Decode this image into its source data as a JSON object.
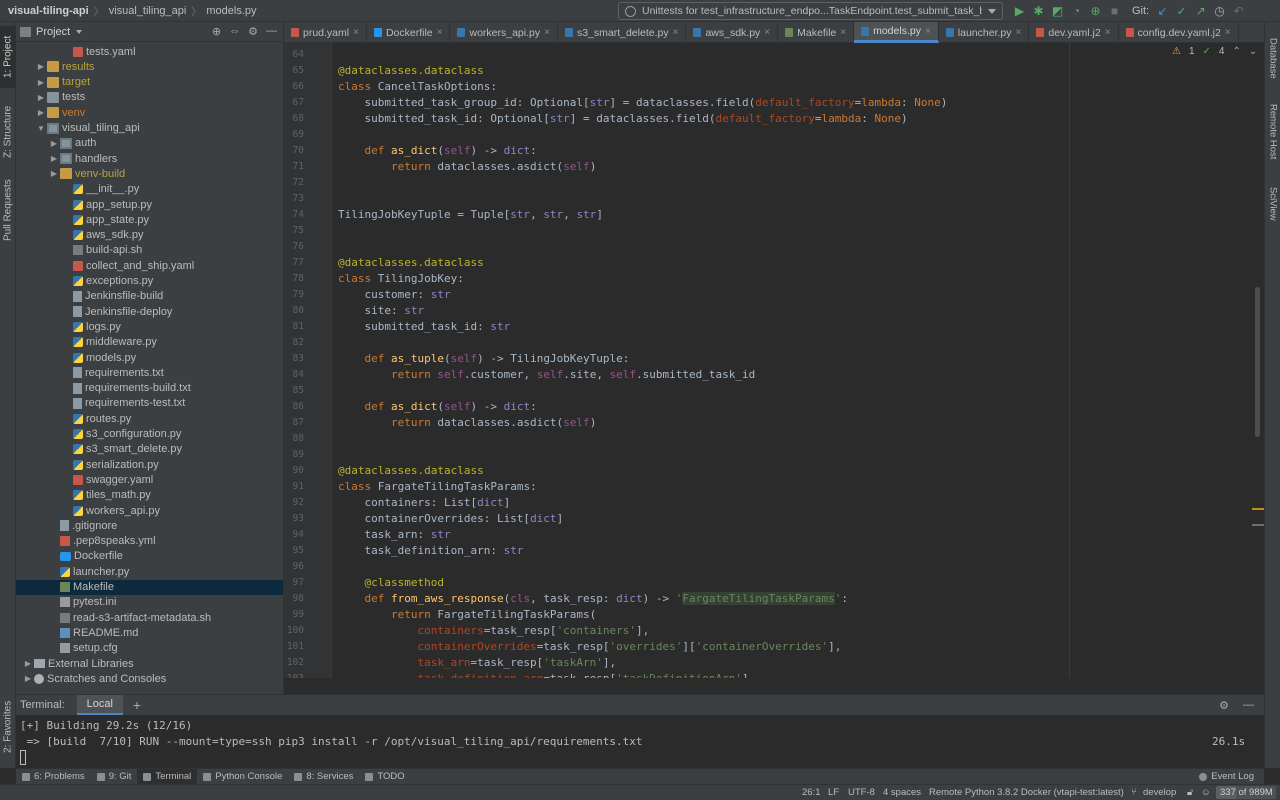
{
  "breadcrumb": {
    "project": "visual-tiling-api",
    "folder": "visual_tiling_api",
    "file": "models.py"
  },
  "run_config": {
    "label": "Unittests for test_infrastructure_endpo...TaskEndpoint.test_submit_task_bad_schema"
  },
  "toolbar": {
    "git_label": "Git:",
    "icons": [
      "run-icon",
      "debug-icon",
      "coverage-icon",
      "profile-icon",
      "concurrency-icon",
      "stop-icon",
      "git-update-icon",
      "git-commit-icon",
      "git-push-icon",
      "history-icon",
      "rollback-icon"
    ]
  },
  "left_strip": {
    "project_tab": "1: Project",
    "structure_tab": "Z: Structure",
    "pull_requests_tab": "Pull Requests",
    "favorites_tab": "2: Favorites"
  },
  "right_strip": {
    "database_tab": "Database",
    "remote_host_tab": "Remote Host",
    "sciview_tab": "SciView"
  },
  "project_panel": {
    "title": "Project",
    "rows": [
      {
        "label": "tests.yaml",
        "indent": 3,
        "icon": "yaml",
        "arrow": "",
        "style": ""
      },
      {
        "label": "results",
        "indent": 1,
        "icon": "folder-excl",
        "arrow": "▶",
        "style": "yellow"
      },
      {
        "label": "target",
        "indent": 1,
        "icon": "folder-excl",
        "arrow": "▶",
        "style": "yellow"
      },
      {
        "label": "tests",
        "indent": 1,
        "icon": "folder",
        "arrow": "▶",
        "style": ""
      },
      {
        "label": "venv",
        "indent": 1,
        "icon": "folder-excl",
        "arrow": "▶",
        "style": "orange"
      },
      {
        "label": "visual_tiling_api",
        "indent": 1,
        "icon": "folder-pkg",
        "arrow": "▼",
        "style": ""
      },
      {
        "label": "auth",
        "indent": 2,
        "icon": "folder-pkg",
        "arrow": "▶",
        "style": ""
      },
      {
        "label": "handlers",
        "indent": 2,
        "icon": "folder-pkg",
        "arrow": "▶",
        "style": ""
      },
      {
        "label": "venv-build",
        "indent": 2,
        "icon": "folder-excl",
        "arrow": "▶",
        "style": "yellow"
      },
      {
        "label": "__init__.py",
        "indent": 3,
        "icon": "py",
        "arrow": "",
        "style": ""
      },
      {
        "label": "app_setup.py",
        "indent": 3,
        "icon": "py",
        "arrow": "",
        "style": ""
      },
      {
        "label": "app_state.py",
        "indent": 3,
        "icon": "py",
        "arrow": "",
        "style": ""
      },
      {
        "label": "aws_sdk.py",
        "indent": 3,
        "icon": "py",
        "arrow": "",
        "style": ""
      },
      {
        "label": "build-api.sh",
        "indent": 3,
        "icon": "sh",
        "arrow": "",
        "style": ""
      },
      {
        "label": "collect_and_ship.yaml",
        "indent": 3,
        "icon": "yaml",
        "arrow": "",
        "style": ""
      },
      {
        "label": "exceptions.py",
        "indent": 3,
        "icon": "py",
        "arrow": "",
        "style": ""
      },
      {
        "label": "Jenkinsfile-build",
        "indent": 3,
        "icon": "txt",
        "arrow": "",
        "style": ""
      },
      {
        "label": "Jenkinsfile-deploy",
        "indent": 3,
        "icon": "txt",
        "arrow": "",
        "style": ""
      },
      {
        "label": "logs.py",
        "indent": 3,
        "icon": "py",
        "arrow": "",
        "style": ""
      },
      {
        "label": "middleware.py",
        "indent": 3,
        "icon": "py",
        "arrow": "",
        "style": ""
      },
      {
        "label": "models.py",
        "indent": 3,
        "icon": "py",
        "arrow": "",
        "style": ""
      },
      {
        "label": "requirements.txt",
        "indent": 3,
        "icon": "txt",
        "arrow": "",
        "style": ""
      },
      {
        "label": "requirements-build.txt",
        "indent": 3,
        "icon": "txt",
        "arrow": "",
        "style": ""
      },
      {
        "label": "requirements-test.txt",
        "indent": 3,
        "icon": "txt",
        "arrow": "",
        "style": ""
      },
      {
        "label": "routes.py",
        "indent": 3,
        "icon": "py",
        "arrow": "",
        "style": ""
      },
      {
        "label": "s3_configuration.py",
        "indent": 3,
        "icon": "py",
        "arrow": "",
        "style": ""
      },
      {
        "label": "s3_smart_delete.py",
        "indent": 3,
        "icon": "py",
        "arrow": "",
        "style": ""
      },
      {
        "label": "serialization.py",
        "indent": 3,
        "icon": "py",
        "arrow": "",
        "style": ""
      },
      {
        "label": "swagger.yaml",
        "indent": 3,
        "icon": "yaml",
        "arrow": "",
        "style": ""
      },
      {
        "label": "tiles_math.py",
        "indent": 3,
        "icon": "py",
        "arrow": "",
        "style": ""
      },
      {
        "label": "workers_api.py",
        "indent": 3,
        "icon": "py",
        "arrow": "",
        "style": ""
      },
      {
        "label": ".gitignore",
        "indent": 2,
        "icon": "txt",
        "arrow": "",
        "style": ""
      },
      {
        "label": ".pep8speaks.yml",
        "indent": 2,
        "icon": "yaml",
        "arrow": "",
        "style": ""
      },
      {
        "label": "Dockerfile",
        "indent": 2,
        "icon": "docker",
        "arrow": "",
        "style": ""
      },
      {
        "label": "launcher.py",
        "indent": 2,
        "icon": "py",
        "arrow": "",
        "style": ""
      },
      {
        "label": "Makefile",
        "indent": 2,
        "icon": "make",
        "arrow": "",
        "style": "",
        "selected": true
      },
      {
        "label": "pytest.ini",
        "indent": 2,
        "icon": "cfg",
        "arrow": "",
        "style": ""
      },
      {
        "label": "read-s3-artifact-metadata.sh",
        "indent": 2,
        "icon": "sh",
        "arrow": "",
        "style": ""
      },
      {
        "label": "README.md",
        "indent": 2,
        "icon": "md",
        "arrow": "",
        "style": ""
      },
      {
        "label": "setup.cfg",
        "indent": 2,
        "icon": "cfg",
        "arrow": "",
        "style": ""
      },
      {
        "label": "External Libraries",
        "indent": 0,
        "icon": "lib",
        "arrow": "▶",
        "style": ""
      },
      {
        "label": "Scratches and Consoles",
        "indent": 0,
        "icon": "scratch",
        "arrow": "▶",
        "style": ""
      }
    ]
  },
  "editor_tabs": [
    {
      "label": "prud.yaml",
      "icon": "yaml",
      "active": false
    },
    {
      "label": "Dockerfile",
      "icon": "docker",
      "active": false
    },
    {
      "label": "workers_api.py",
      "icon": "py",
      "active": false
    },
    {
      "label": "s3_smart_delete.py",
      "icon": "py",
      "active": false
    },
    {
      "label": "aws_sdk.py",
      "icon": "py",
      "active": false
    },
    {
      "label": "Makefile",
      "icon": "make",
      "active": false
    },
    {
      "label": "models.py",
      "icon": "py",
      "active": true
    },
    {
      "label": "launcher.py",
      "icon": "py",
      "active": false
    },
    {
      "label": "dev.yaml.j2",
      "icon": "yaml",
      "active": false
    },
    {
      "label": "config.dev.yaml.j2",
      "icon": "yaml",
      "active": false
    }
  ],
  "inspections": {
    "warnings": "1",
    "ok": "4"
  },
  "code": {
    "first_line": 64,
    "lines": [
      [],
      [
        [
          "dec",
          "@dataclasses.dataclass"
        ]
      ],
      [
        [
          "kw",
          "class "
        ],
        [
          "",
          "CancelTaskOptions:"
        ]
      ],
      [
        [
          "",
          "    submitted_task_group_id: Optional["
        ],
        [
          "bi",
          "str"
        ],
        [
          "",
          "] = dataclasses.field("
        ],
        [
          "prm",
          "default_factory"
        ],
        [
          "",
          "="
        ],
        [
          "kw",
          "lambda"
        ],
        [
          "",
          ": "
        ],
        [
          "kw",
          "None"
        ],
        [
          "",
          ")"
        ]
      ],
      [
        [
          "",
          "    submitted_task_id: Optional["
        ],
        [
          "bi",
          "str"
        ],
        [
          "",
          "] = dataclasses.field("
        ],
        [
          "prm",
          "default_factory"
        ],
        [
          "",
          "="
        ],
        [
          "kw",
          "lambda"
        ],
        [
          "",
          ": "
        ],
        [
          "kw",
          "None"
        ],
        [
          "",
          ")"
        ]
      ],
      [],
      [
        [
          "kw",
          "    def "
        ],
        [
          "fn",
          "as_dict"
        ],
        [
          "",
          "("
        ],
        [
          "slf",
          "self"
        ],
        [
          "",
          ") -> "
        ],
        [
          "bi",
          "dict"
        ],
        [
          "",
          ":"
        ]
      ],
      [
        [
          "kw",
          "        return "
        ],
        [
          "",
          "dataclasses.asdict("
        ],
        [
          "slf",
          "self"
        ],
        [
          "",
          ")"
        ]
      ],
      [],
      [],
      [
        [
          "",
          "TilingJobKeyTuple = Tuple["
        ],
        [
          "bi",
          "str"
        ],
        [
          "",
          ", "
        ],
        [
          "bi",
          "str"
        ],
        [
          "",
          ", "
        ],
        [
          "bi",
          "str"
        ],
        [
          "",
          "]"
        ]
      ],
      [],
      [],
      [
        [
          "dec",
          "@dataclasses.dataclass"
        ]
      ],
      [
        [
          "kw",
          "class "
        ],
        [
          "",
          "TilingJobKey:"
        ]
      ],
      [
        [
          "",
          "    customer: "
        ],
        [
          "bi",
          "str"
        ]
      ],
      [
        [
          "",
          "    site: "
        ],
        [
          "bi",
          "str"
        ]
      ],
      [
        [
          "",
          "    submitted_task_id: "
        ],
        [
          "bi",
          "str"
        ]
      ],
      [],
      [
        [
          "kw",
          "    def "
        ],
        [
          "fn",
          "as_tuple"
        ],
        [
          "",
          "("
        ],
        [
          "slf",
          "self"
        ],
        [
          "",
          ") -> TilingJobKeyTuple:"
        ]
      ],
      [
        [
          "kw",
          "        return "
        ],
        [
          "slf",
          "self"
        ],
        [
          "",
          ".customer, "
        ],
        [
          "slf",
          "self"
        ],
        [
          "",
          ".site, "
        ],
        [
          "slf",
          "self"
        ],
        [
          "",
          ".submitted_task_id"
        ]
      ],
      [],
      [
        [
          "kw",
          "    def "
        ],
        [
          "fn",
          "as_dict"
        ],
        [
          "",
          "("
        ],
        [
          "slf",
          "self"
        ],
        [
          "",
          ") -> "
        ],
        [
          "bi",
          "dict"
        ],
        [
          "",
          ":"
        ]
      ],
      [
        [
          "kw",
          "        return "
        ],
        [
          "",
          "dataclasses.asdict("
        ],
        [
          "slf",
          "self"
        ],
        [
          "",
          ")"
        ]
      ],
      [],
      [],
      [
        [
          "dec",
          "@dataclasses.dataclass"
        ]
      ],
      [
        [
          "kw",
          "class "
        ],
        [
          "",
          "FargateTilingTaskParams:"
        ]
      ],
      [
        [
          "",
          "    containers: List["
        ],
        [
          "bi",
          "dict"
        ],
        [
          "",
          "]"
        ]
      ],
      [
        [
          "",
          "    containerOverrides: List["
        ],
        [
          "bi",
          "dict"
        ],
        [
          "",
          "]"
        ]
      ],
      [
        [
          "",
          "    task_arn: "
        ],
        [
          "bi",
          "str"
        ]
      ],
      [
        [
          "",
          "    task_definition_arn: "
        ],
        [
          "bi",
          "str"
        ]
      ],
      [],
      [
        [
          "dec",
          "    @classmethod"
        ]
      ],
      [
        [
          "kw",
          "    def "
        ],
        [
          "fn",
          "from_aws_response"
        ],
        [
          "",
          "("
        ],
        [
          "slf",
          "cls"
        ],
        [
          "",
          ", task_resp: "
        ],
        [
          "bi",
          "dict"
        ],
        [
          "",
          ") -> "
        ],
        [
          "str",
          "'"
        ],
        [
          "str hl",
          "FargateTilingTaskParams"
        ],
        [
          "str",
          "'"
        ],
        [
          "",
          ":"
        ]
      ],
      [
        [
          "kw",
          "        return "
        ],
        [
          "",
          "FargateTilingTaskParams("
        ]
      ],
      [
        [
          "prm",
          "            containers"
        ],
        [
          "",
          "=task_resp["
        ],
        [
          "str",
          "'containers'"
        ],
        [
          "",
          "],"
        ]
      ],
      [
        [
          "prm",
          "            containerOverrides"
        ],
        [
          "",
          "=task_resp["
        ],
        [
          "str",
          "'overrides'"
        ],
        [
          "",
          "]["
        ],
        [
          "str",
          "'containerOverrides'"
        ],
        [
          "",
          "],"
        ]
      ],
      [
        [
          "prm",
          "            task_arn"
        ],
        [
          "",
          "=task_resp["
        ],
        [
          "str",
          "'taskArn'"
        ],
        [
          "",
          "],"
        ]
      ],
      [
        [
          "prm",
          "            task_definition_arn"
        ],
        [
          "",
          "=task_resp["
        ],
        [
          "str",
          "'taskDefinitionArn'"
        ],
        [
          "",
          "],"
        ]
      ]
    ]
  },
  "terminal": {
    "title": "Terminal:",
    "tab": "Local",
    "add_label": "+",
    "line1": "[+] Building 29.2s (12/16)",
    "line2": " => [build  7/10] RUN --mount=type=ssh pip3 install -r /opt/visual_tiling_api/requirements.txt",
    "time": "26.1s"
  },
  "tool_windows": [
    {
      "label": "6: Problems",
      "active": false
    },
    {
      "label": "9: Git",
      "active": false
    },
    {
      "label": "Terminal",
      "active": true
    },
    {
      "label": "Python Console",
      "active": false
    },
    {
      "label": "8: Services",
      "active": false
    },
    {
      "label": "TODO",
      "active": false
    }
  ],
  "event_log": "Event Log",
  "status": {
    "position": "26:1",
    "line_sep": "LF",
    "encoding": "UTF-8",
    "indent": "4 spaces",
    "interpreter": "Remote Python 3.8.2 Docker (vtapi-test:latest)",
    "branch": "develop",
    "memory": "337 of 989M",
    "memory_fraction": 0.34
  }
}
